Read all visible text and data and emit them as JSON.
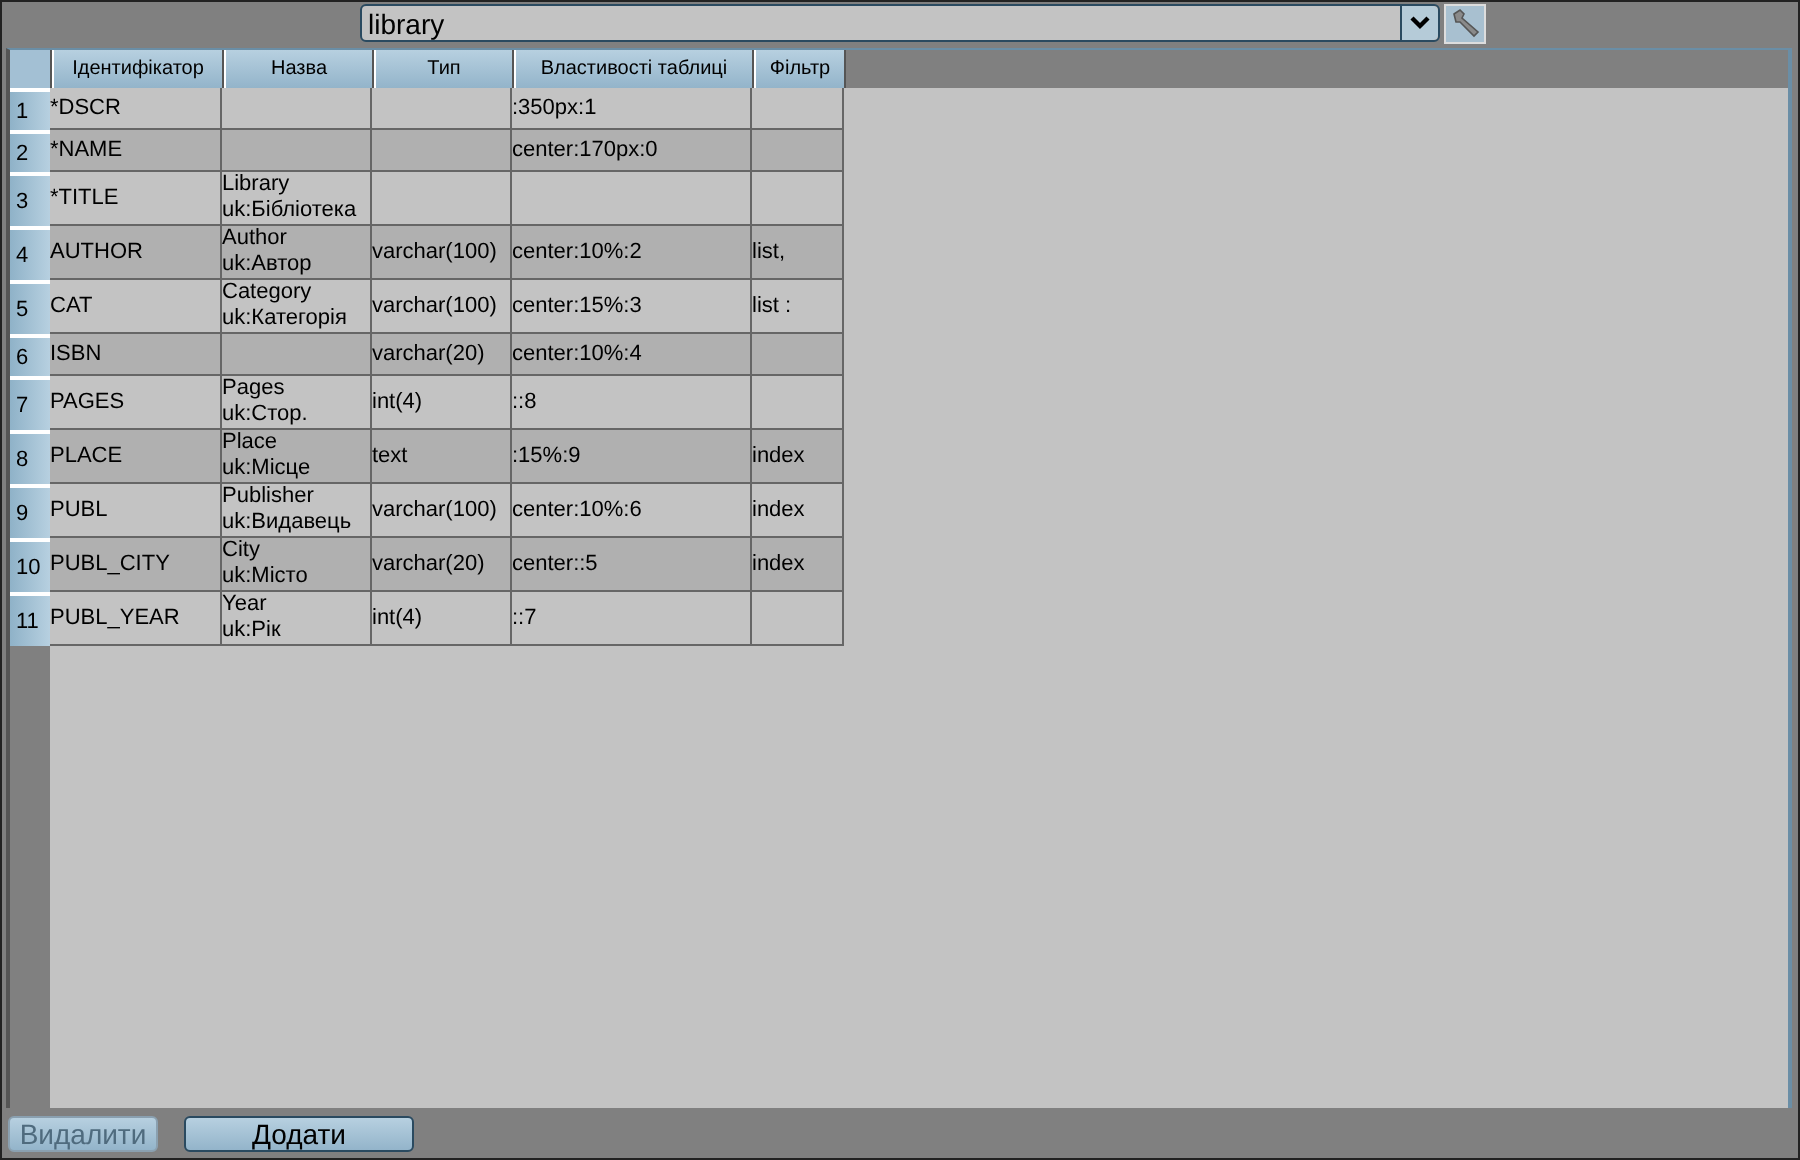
{
  "selector": {
    "value": "library"
  },
  "table": {
    "columns": [
      "Ідентифікатор",
      "Назва",
      "Тип",
      "Властивості таблиці",
      "Фільтр"
    ],
    "rows": [
      {
        "number": "1",
        "id": "*DSCR",
        "name": [],
        "type": "",
        "props": ":350px:1",
        "filter": ""
      },
      {
        "number": "2",
        "id": "*NAME",
        "name": [],
        "type": "",
        "props": "center:170px:0",
        "filter": ""
      },
      {
        "number": "3",
        "id": "*TITLE",
        "name": [
          "Library",
          "uk:Бібліотека"
        ],
        "type": "",
        "props": "",
        "filter": ""
      },
      {
        "number": "4",
        "id": "AUTHOR",
        "name": [
          "Author",
          "uk:Автор"
        ],
        "type": "varchar(100)",
        "props": "center:10%:2",
        "filter": "list,"
      },
      {
        "number": "5",
        "id": "CAT",
        "name": [
          "Category",
          "uk:Категорія"
        ],
        "type": "varchar(100)",
        "props": "center:15%:3",
        "filter": "list :"
      },
      {
        "number": "6",
        "id": "ISBN",
        "name": [],
        "type": "varchar(20)",
        "props": "center:10%:4",
        "filter": ""
      },
      {
        "number": "7",
        "id": "PAGES",
        "name": [
          "Pages",
          "uk:Стор."
        ],
        "type": "int(4)",
        "props": "::8",
        "filter": ""
      },
      {
        "number": "8",
        "id": "PLACE",
        "name": [
          "Place",
          "uk:Місце"
        ],
        "type": "text",
        "props": ":15%:9",
        "filter": "index"
      },
      {
        "number": "9",
        "id": "PUBL",
        "name": [
          "Publisher",
          "uk:Видавець"
        ],
        "type": "varchar(100)",
        "props": "center:10%:6",
        "filter": "index"
      },
      {
        "number": "10",
        "id": "PUBL_CITY",
        "name": [
          "City",
          "uk:Місто"
        ],
        "type": "varchar(20)",
        "props": "center::5",
        "filter": "index"
      },
      {
        "number": "11",
        "id": "PUBL_YEAR",
        "name": [
          "Year",
          "uk:Рік"
        ],
        "type": "int(4)",
        "props": "::7",
        "filter": ""
      }
    ]
  },
  "buttons": [
    {
      "label": "Видалити",
      "disabled": true
    },
    {
      "label": "Додати",
      "disabled": false
    }
  ]
}
